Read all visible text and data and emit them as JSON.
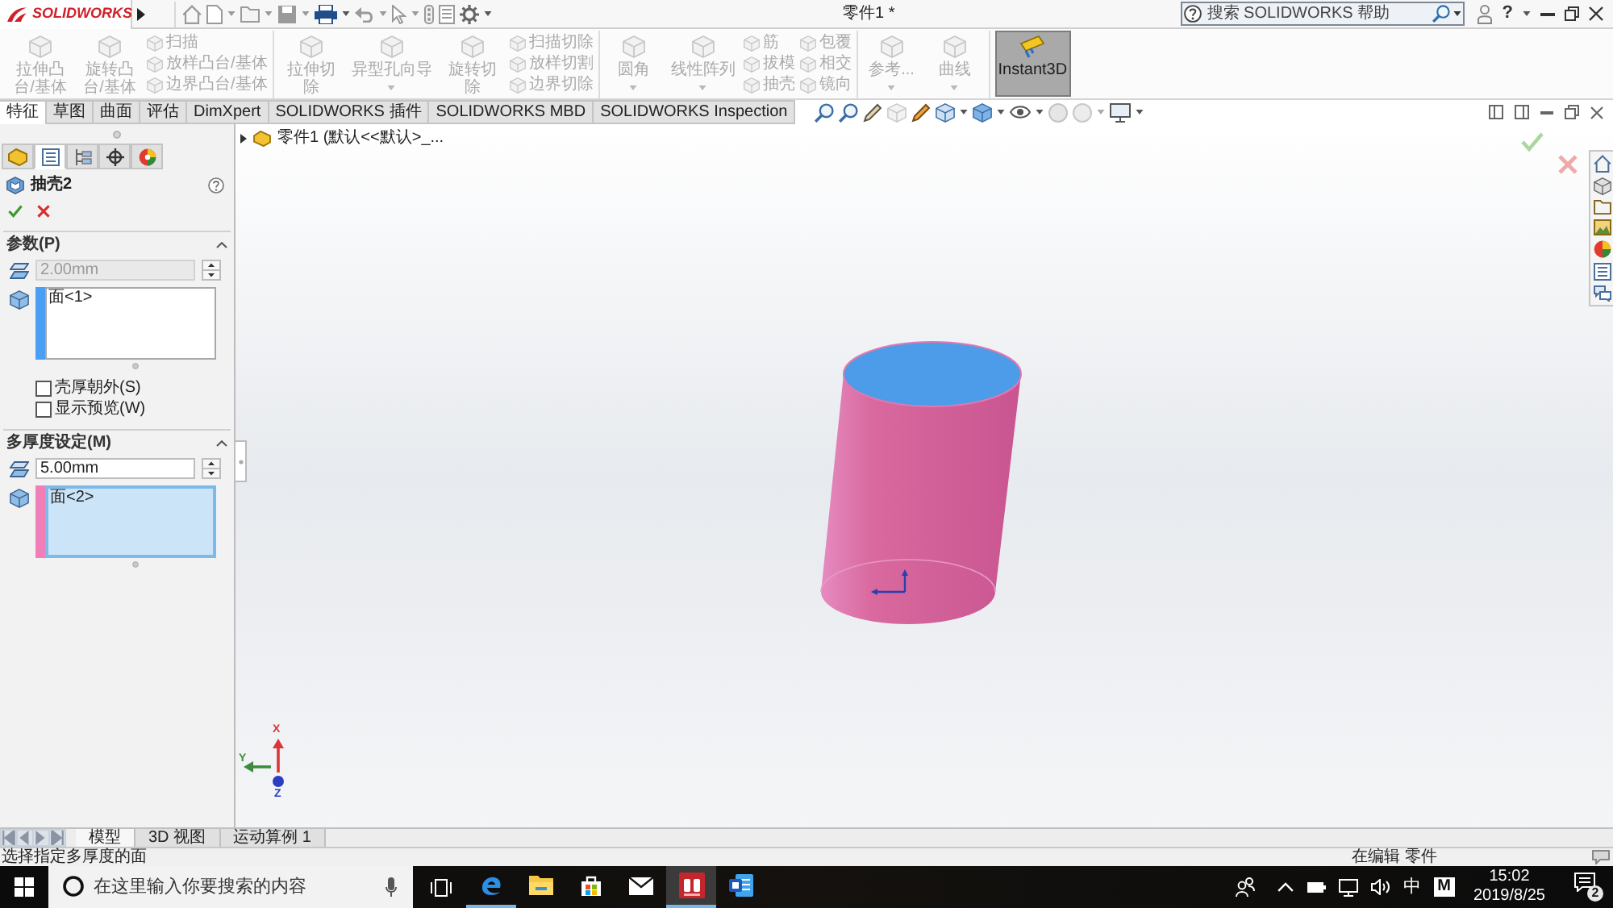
{
  "title_bar": {
    "logo": "SOLIDWORKS",
    "title": "零件1 *",
    "search": {
      "placeholder": "搜索 SOLIDWORKS 帮助"
    },
    "help": "?"
  },
  "ribbon": {
    "groups": [
      {
        "items": [
          {
            "kind": "large",
            "label": "拉伸凸台/基体",
            "disabled": true,
            "dropdown": false
          },
          {
            "kind": "large",
            "label": "旋转凸台/基体",
            "disabled": true,
            "dropdown": false
          },
          {
            "kind": "stack",
            "items": [
              {
                "label": "扫描",
                "disabled": true
              },
              {
                "label": "放样凸台/基体",
                "disabled": true
              },
              {
                "label": "边界凸台/基体",
                "disabled": true
              }
            ]
          }
        ]
      },
      {
        "items": [
          {
            "kind": "large",
            "label": "拉伸切除",
            "disabled": true,
            "dropdown": false
          },
          {
            "kind": "large",
            "label": "异型孔向导",
            "disabled": true,
            "dropdown": true
          },
          {
            "kind": "large",
            "label": "旋转切除",
            "disabled": true,
            "dropdown": false
          },
          {
            "kind": "stack",
            "items": [
              {
                "label": "扫描切除",
                "disabled": true
              },
              {
                "label": "放样切割",
                "disabled": true
              },
              {
                "label": "边界切除",
                "disabled": true
              }
            ]
          }
        ]
      },
      {
        "items": [
          {
            "kind": "large",
            "label": "圆角",
            "disabled": true,
            "dropdown": true
          },
          {
            "kind": "large",
            "label": "线性阵列",
            "disabled": true,
            "dropdown": true
          },
          {
            "kind": "stack",
            "items": [
              {
                "label": "筋",
                "disabled": true
              },
              {
                "label": "拔模",
                "disabled": true
              },
              {
                "label": "抽壳",
                "disabled": true
              }
            ]
          },
          {
            "kind": "stack",
            "items": [
              {
                "label": "包覆",
                "disabled": true
              },
              {
                "label": "相交",
                "disabled": true
              },
              {
                "label": "镜向",
                "disabled": true
              }
            ]
          }
        ]
      },
      {
        "items": [
          {
            "kind": "large",
            "label": "参考...",
            "disabled": true,
            "dropdown": true
          },
          {
            "kind": "large",
            "label": "曲线",
            "disabled": true,
            "dropdown": true
          }
        ]
      },
      {
        "items": [
          {
            "kind": "toggle",
            "label": "Instant3D",
            "disabled": false,
            "selected": true
          }
        ]
      }
    ]
  },
  "command_tabs": [
    {
      "label": "特征",
      "selected": true
    },
    {
      "label": "草图",
      "selected": false
    },
    {
      "label": "曲面",
      "selected": false
    },
    {
      "label": "评估",
      "selected": false
    },
    {
      "label": "DimXpert",
      "selected": false
    },
    {
      "label": "SOLIDWORKS 插件",
      "selected": false
    },
    {
      "label": "SOLIDWORKS MBD",
      "selected": false
    },
    {
      "label": "SOLIDWORKS Inspection",
      "selected": false
    }
  ],
  "property_manager": {
    "tabs": [
      {
        "selected": false
      },
      {
        "selected": true
      },
      {
        "selected": false
      },
      {
        "selected": false
      },
      {
        "selected": false
      }
    ],
    "title": "抽壳2",
    "sections": [
      {
        "title": "参数(P)",
        "expanded": true,
        "thickness": {
          "value": "2.00mm",
          "disabled": true
        },
        "faces": {
          "items": [
            "面<1>"
          ],
          "color": "#4a9ff5",
          "active": false
        },
        "options": [
          {
            "label": "壳厚朝外(S)",
            "checked": false
          },
          {
            "label": "显示预览(W)",
            "checked": false
          }
        ]
      },
      {
        "title": "多厚度设定(M)",
        "expanded": true,
        "thickness": {
          "value": "5.00mm",
          "disabled": false
        },
        "faces": {
          "items": [
            "面<2>"
          ],
          "color": "#f07fb8",
          "active": true
        }
      }
    ]
  },
  "graphics": {
    "tree": {
      "label": "零件1 (默认<<默认>_...",
      "expanded": false
    },
    "triad": {
      "axes": [
        {
          "label": "X",
          "color": "#d9363a"
        },
        {
          "label": "Y",
          "color": "#3c8c3c"
        },
        {
          "label": "Z",
          "color": "#2a3cc0"
        }
      ]
    }
  },
  "bottom_tabs": [
    {
      "label": "模型",
      "selected": true
    },
    {
      "label": "3D 视图",
      "selected": false
    },
    {
      "label": "运动算例 1",
      "selected": false
    }
  ],
  "status_bar": {
    "message": "选择指定多厚度的面",
    "mode": "在编辑 零件"
  },
  "taskbar": {
    "search": {
      "placeholder": "在这里输入你要搜索的内容"
    },
    "apps": [
      {
        "kind": "browser",
        "running": true,
        "active": false
      },
      {
        "kind": "folder",
        "running": false,
        "active": false
      },
      {
        "kind": "store",
        "running": false,
        "active": false
      },
      {
        "kind": "mail",
        "running": false,
        "active": false
      },
      {
        "kind": "cad",
        "running": true,
        "active": true
      },
      {
        "kind": "document",
        "running": false,
        "active": false
      }
    ],
    "ime": "中",
    "ime_mode": "M",
    "time": "15:02",
    "date": "2019/8/25",
    "notifications": "2"
  }
}
